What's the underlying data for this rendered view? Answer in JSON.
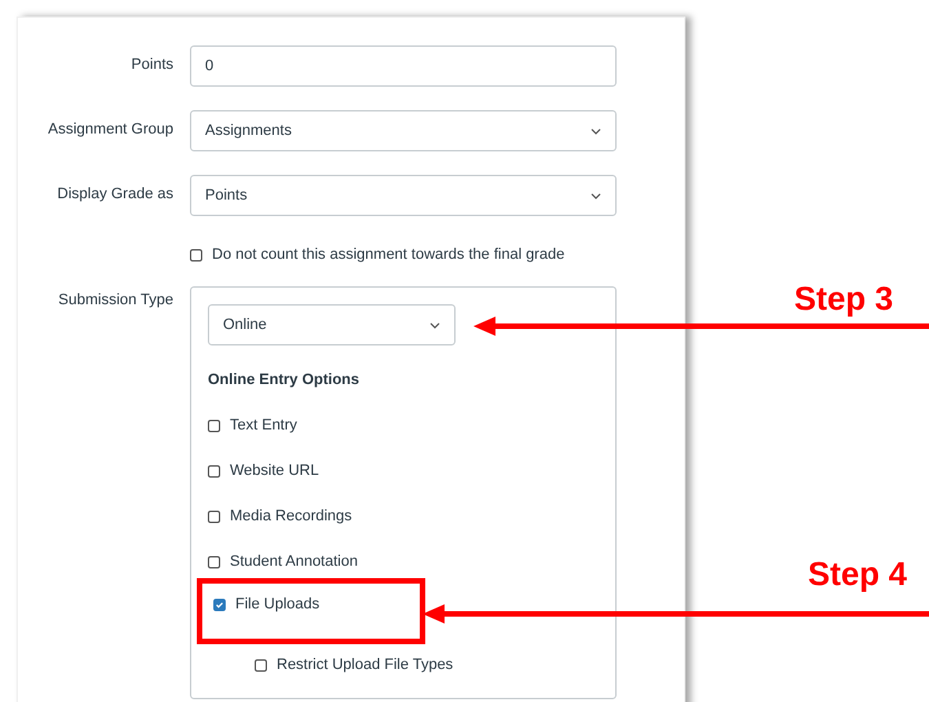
{
  "fields": [
    {
      "label": "Points",
      "kind": "input",
      "value": "0"
    },
    {
      "label": "Assignment Group",
      "kind": "select",
      "value": "Assignments"
    },
    {
      "label": "Display Grade as",
      "kind": "select",
      "value": "Points"
    }
  ],
  "grade_option": {
    "label": "Do not count this assignment towards the final grade",
    "checked": false
  },
  "submission": {
    "label": "Submission Type",
    "value": "Online",
    "annotation": "Step 3",
    "options_heading": "Online Entry Options",
    "options": [
      {
        "label": "Text Entry",
        "checked": false,
        "highlighted": false
      },
      {
        "label": "Website URL",
        "checked": false,
        "highlighted": false
      },
      {
        "label": "Media Recordings",
        "checked": false,
        "highlighted": false
      },
      {
        "label": "Student Annotation",
        "checked": false,
        "highlighted": false
      },
      {
        "label": "File Uploads",
        "checked": true,
        "highlighted": true,
        "annotation": "Step 4",
        "children": [
          {
            "label": "Restrict Upload File Types",
            "checked": false
          }
        ]
      }
    ]
  }
}
